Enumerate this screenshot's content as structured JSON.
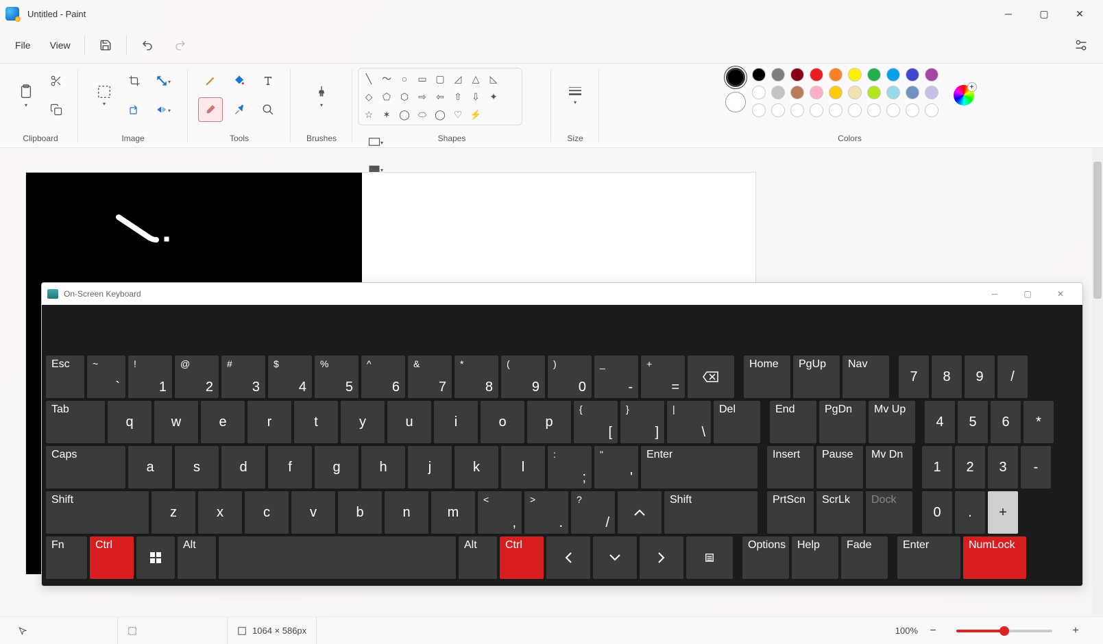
{
  "titlebar": {
    "title": "Untitled - Paint"
  },
  "menubar": {
    "file": "File",
    "view": "View"
  },
  "ribbon": {
    "clipboard_label": "Clipboard",
    "image_label": "Image",
    "tools_label": "Tools",
    "brushes_label": "Brushes",
    "shapes_label": "Shapes",
    "size_label": "Size",
    "colors_label": "Colors"
  },
  "colors": {
    "primary": "#000000",
    "secondary": "#ffffff",
    "row1": [
      "#000000",
      "#7f7f7f",
      "#880015",
      "#ed1c24",
      "#ff7f27",
      "#fff200",
      "#22b14c",
      "#00a2e8",
      "#3f48cc",
      "#a349a4"
    ],
    "row2": [
      "#ffffff",
      "#c3c3c3",
      "#b97a57",
      "#ffaec9",
      "#ffc90e",
      "#efe4b0",
      "#b5e61d",
      "#99d9ea",
      "#7092be",
      "#c8bfe7"
    ],
    "row3": [
      "#ffffff",
      "#ffffff",
      "#ffffff",
      "#ffffff",
      "#ffffff",
      "#ffffff",
      "#ffffff",
      "#ffffff",
      "#ffffff",
      "#ffffff"
    ]
  },
  "canvas": {
    "dimensions": "1064 × 586px"
  },
  "osk": {
    "title": "On-Screen Keyboard",
    "row1": {
      "esc": "Esc",
      "k1": [
        "~",
        "`"
      ],
      "k2": [
        "!",
        "1"
      ],
      "k3": [
        "@",
        "2"
      ],
      "k4": [
        "#",
        "3"
      ],
      "k5": [
        "$",
        "4"
      ],
      "k6": [
        "%",
        "5"
      ],
      "k7": [
        "^",
        "6"
      ],
      "k8": [
        "&",
        "7"
      ],
      "k9": [
        "*",
        "8"
      ],
      "k10": [
        "(",
        "9"
      ],
      "k11": [
        ")",
        "0"
      ],
      "k12": [
        "_",
        "-"
      ],
      "k13": [
        "+",
        "="
      ],
      "home": "Home",
      "pgup": "PgUp",
      "nav": "Nav",
      "n7": "7",
      "n8": "8",
      "n9": "9",
      "ndiv": "/"
    },
    "row2": {
      "tab": "Tab",
      "q": "q",
      "w": "w",
      "e": "e",
      "r": "r",
      "t": "t",
      "y": "y",
      "u": "u",
      "i": "i",
      "o": "o",
      "p": "p",
      "br1": [
        "{",
        "["
      ],
      "br2": [
        "}",
        "]"
      ],
      "del": "Del",
      "bs": [
        "|",
        "\\"
      ],
      "end": "End",
      "pgdn": "PgDn",
      "mvup": "Mv Up",
      "n4": "4",
      "n5": "5",
      "n6": "6",
      "nmul": "*"
    },
    "row3": {
      "caps": "Caps",
      "a": "a",
      "s": "s",
      "d": "d",
      "f": "f",
      "g": "g",
      "h": "h",
      "j": "j",
      "k": "k",
      "l": "l",
      "sc": [
        ":",
        ";"
      ],
      "qt": [
        "\"",
        "'"
      ],
      "enter": "Enter",
      "insert": "Insert",
      "pause": "Pause",
      "mvdn": "Mv Dn",
      "n1": "1",
      "n2": "2",
      "n3": "3",
      "nsub": "-"
    },
    "row4": {
      "shift": "Shift",
      "z": "z",
      "x": "x",
      "c": "c",
      "v": "v",
      "b": "b",
      "n": "n",
      "m": "m",
      "lt": [
        "<",
        ","
      ],
      "gt": [
        ">",
        "."
      ],
      "sl": [
        "?",
        "/"
      ],
      "up": "▲",
      "shift2": "Shift",
      "prtscn": "PrtScn",
      "scrlk": "ScrLk",
      "dock": "Dock",
      "n0": "0",
      "ndot": ".",
      "nadd": "+"
    },
    "row5": {
      "fn": "Fn",
      "ctrl": "Ctrl",
      "alt": "Alt",
      "alt2": "Alt",
      "ctrl2": "Ctrl",
      "left": "◄",
      "down": "▼",
      "right": "►",
      "options": "Options",
      "help": "Help",
      "fade": "Fade",
      "enter": "Enter",
      "numlock": "NumLock"
    }
  },
  "statusbar": {
    "zoom": "100%"
  }
}
